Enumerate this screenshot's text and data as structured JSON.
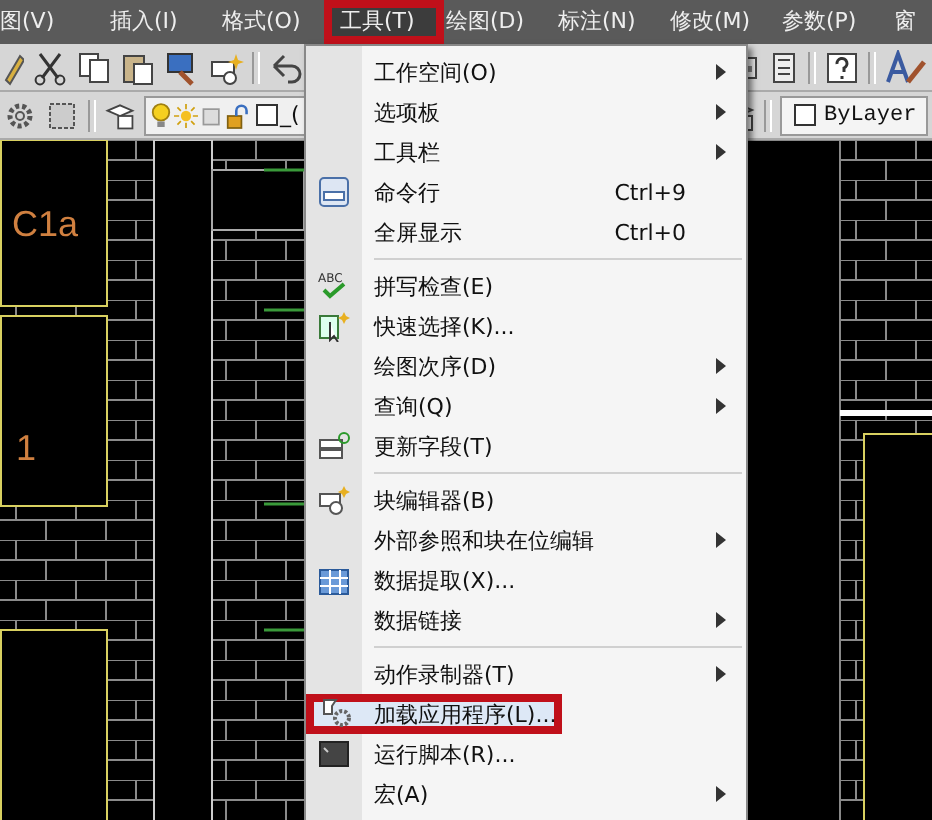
{
  "menubar": [
    {
      "label": "图(V)",
      "selected": false,
      "annotated": false
    },
    {
      "label": "插入(I)",
      "selected": false,
      "annotated": false
    },
    {
      "label": "格式(O)",
      "selected": false,
      "annotated": false
    },
    {
      "label": "工具(T)",
      "selected": true,
      "annotated": true
    },
    {
      "label": "绘图(D)",
      "selected": false,
      "annotated": false
    },
    {
      "label": "标注(N)",
      "selected": false,
      "annotated": false
    },
    {
      "label": "修改(M)",
      "selected": false,
      "annotated": false
    },
    {
      "label": "参数(P)",
      "selected": false,
      "annotated": false
    },
    {
      "label": "窗",
      "selected": false,
      "annotated": false
    }
  ],
  "toolbar": {
    "layer_name": "_(",
    "linetype": "ByLayer"
  },
  "drawing": {
    "labels": [
      "C1a",
      "1"
    ]
  },
  "menu": [
    {
      "kind": "item",
      "label": "工作空间(O)",
      "submenu": true,
      "highlighted": false,
      "annotated": false
    },
    {
      "kind": "item",
      "label": "选项板",
      "submenu": true,
      "highlighted": false,
      "annotated": false
    },
    {
      "kind": "item",
      "label": "工具栏",
      "submenu": true,
      "highlighted": false,
      "annotated": false
    },
    {
      "kind": "item",
      "label": "命令行",
      "shortcut": "Ctrl+9",
      "submenu": false,
      "highlighted": false,
      "annotated": false
    },
    {
      "kind": "item",
      "label": "全屏显示",
      "shortcut": "Ctrl+0",
      "submenu": false,
      "highlighted": false,
      "annotated": false
    },
    {
      "kind": "separator"
    },
    {
      "kind": "item",
      "label": "拼写检查(E)",
      "icon_text": "ABC",
      "submenu": false,
      "highlighted": false,
      "annotated": false
    },
    {
      "kind": "item",
      "label": "快速选择(K)...",
      "submenu": false,
      "highlighted": false,
      "annotated": false
    },
    {
      "kind": "item",
      "label": "绘图次序(D)",
      "submenu": true,
      "highlighted": false,
      "annotated": false
    },
    {
      "kind": "item",
      "label": "查询(Q)",
      "submenu": true,
      "highlighted": false,
      "annotated": false
    },
    {
      "kind": "item",
      "label": "更新字段(T)",
      "submenu": false,
      "highlighted": false,
      "annotated": false
    },
    {
      "kind": "separator"
    },
    {
      "kind": "item",
      "label": "块编辑器(B)",
      "submenu": false,
      "highlighted": false,
      "annotated": false
    },
    {
      "kind": "item",
      "label": "外部参照和块在位编辑",
      "submenu": true,
      "highlighted": false,
      "annotated": false
    },
    {
      "kind": "item",
      "label": "数据提取(X)...",
      "submenu": false,
      "highlighted": false,
      "annotated": false
    },
    {
      "kind": "item",
      "label": "数据链接",
      "submenu": true,
      "highlighted": false,
      "annotated": false
    },
    {
      "kind": "separator"
    },
    {
      "kind": "item",
      "label": "动作录制器(T)",
      "submenu": true,
      "highlighted": false,
      "annotated": false
    },
    {
      "kind": "item",
      "label": "加载应用程序(L)...",
      "submenu": false,
      "highlighted": true,
      "annotated": true
    },
    {
      "kind": "item",
      "label": "运行脚本(R)...",
      "submenu": false,
      "highlighted": false,
      "annotated": false
    },
    {
      "kind": "item",
      "label": "宏(A)",
      "submenu": true,
      "highlighted": false,
      "annotated": false
    }
  ]
}
